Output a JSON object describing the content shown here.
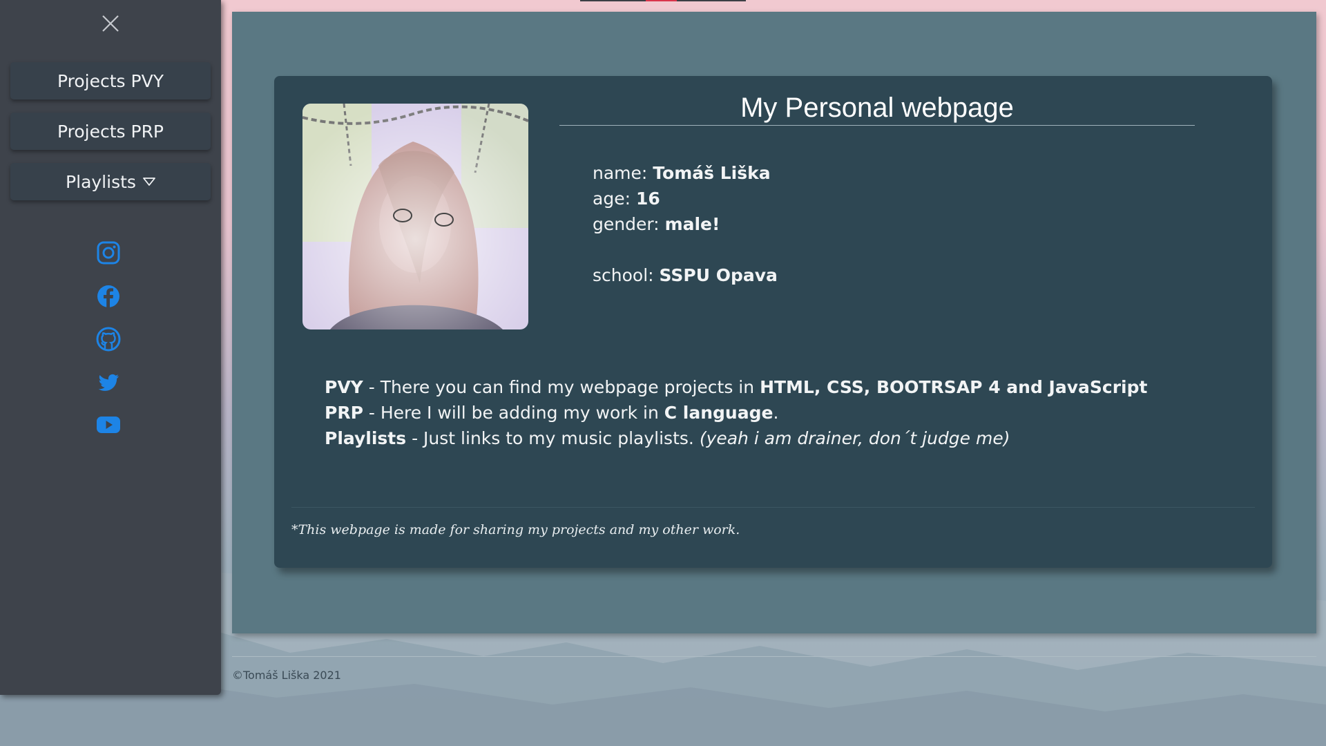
{
  "sidebar": {
    "close_icon": "close-icon",
    "items": [
      {
        "label": "Projects PVY"
      },
      {
        "label": "Projects PRP"
      },
      {
        "label": "Playlists",
        "icon": "caret-down-icon"
      }
    ],
    "social": [
      "instagram-icon",
      "facebook-icon",
      "github-icon",
      "twitter-icon",
      "youtube-icon"
    ],
    "accent_color": "#1d84e6"
  },
  "card": {
    "title": "My Personal webpage",
    "info": {
      "name_label": "name:",
      "name_value": "Tomáš Liška",
      "age_label": "age:",
      "age_value": "16",
      "gender_label": "gender:",
      "gender_value": "male!",
      "school_label": "school:",
      "school_value": "SSPU Opava"
    },
    "description": {
      "pvy_key": "PVY",
      "pvy_text": " - There you can find my webpage projects in ",
      "pvy_bold": "HTML, CSS, BOOTRSAP 4 and JavaScript",
      "prp_key": "PRP",
      "prp_text": " - Here I will be adding my work in ",
      "prp_bold": "C language",
      "prp_end": ".",
      "playlists_key": "Playlists",
      "playlists_text": " - Just links to my music playlists. ",
      "playlists_italic": "(yeah i am drainer, don´t judge me)"
    },
    "note": "*This webpage is made for sharing my projects and my other work."
  },
  "footer": {
    "copyright": "©Tomáš Liška 2021"
  }
}
